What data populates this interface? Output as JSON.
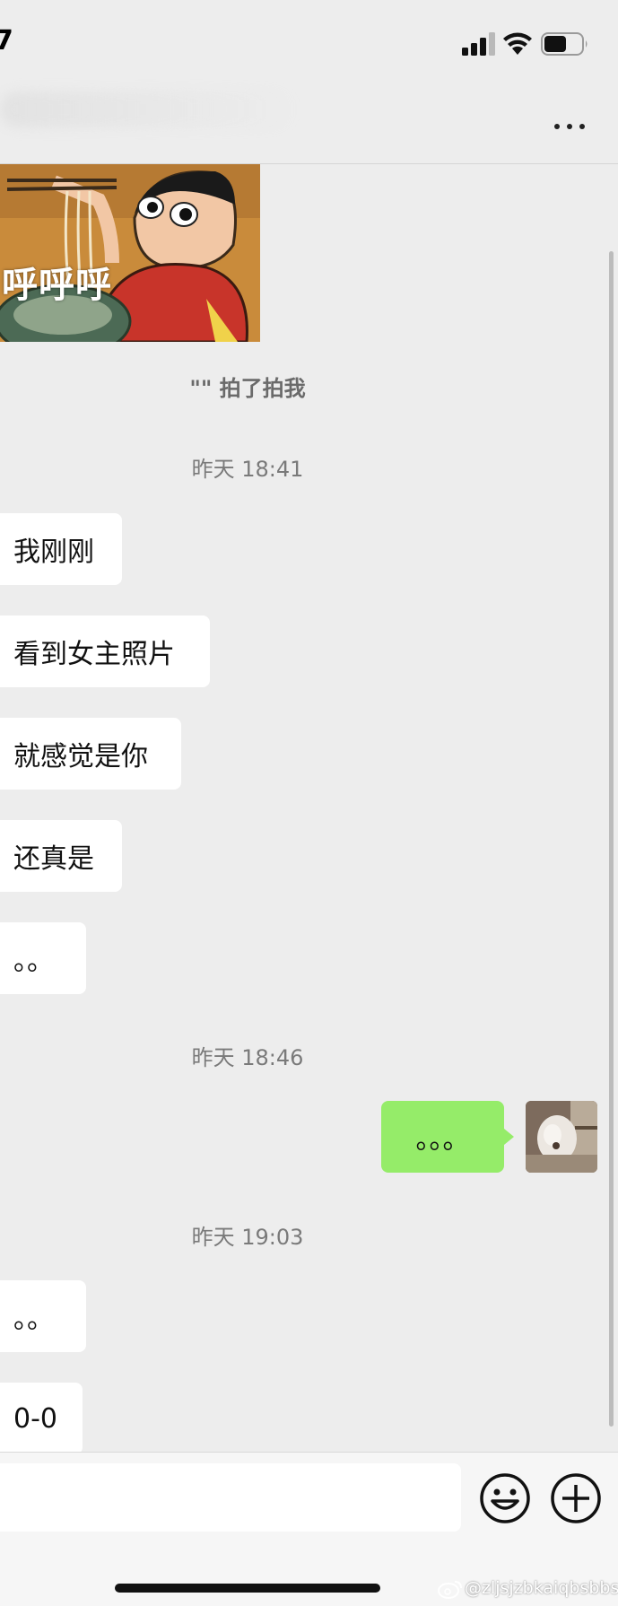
{
  "status_bar": {
    "time": "7",
    "icons": [
      "signal-icon",
      "wifi-icon",
      "battery-icon"
    ],
    "battery_level": 0.6
  },
  "nav": {
    "more_icon": "more-icon"
  },
  "chat": {
    "sticker": {
      "caption": "呼呼呼"
    },
    "pat_notice": "\"\" 拍了拍我",
    "timestamps": [
      "昨天 18:41",
      "昨天 18:46",
      "昨天 19:03"
    ],
    "received_group_1": [
      "我刚刚",
      "看到女主照片",
      "就感觉是你",
      "还真是",
      "。。"
    ],
    "sent_message": "。。。",
    "received_group_2": [
      "。。",
      "0-0"
    ]
  },
  "input_bar": {
    "input_value": "",
    "emoji_icon": "emoji-icon",
    "plus_icon": "plus-icon"
  },
  "watermark": "@zljsjzbkaiqbsbbsij",
  "colors": {
    "background": "#ededed",
    "incoming_bubble": "#ffffff",
    "outgoing_bubble": "#95ec69",
    "meta_text": "#7a7a7a"
  }
}
